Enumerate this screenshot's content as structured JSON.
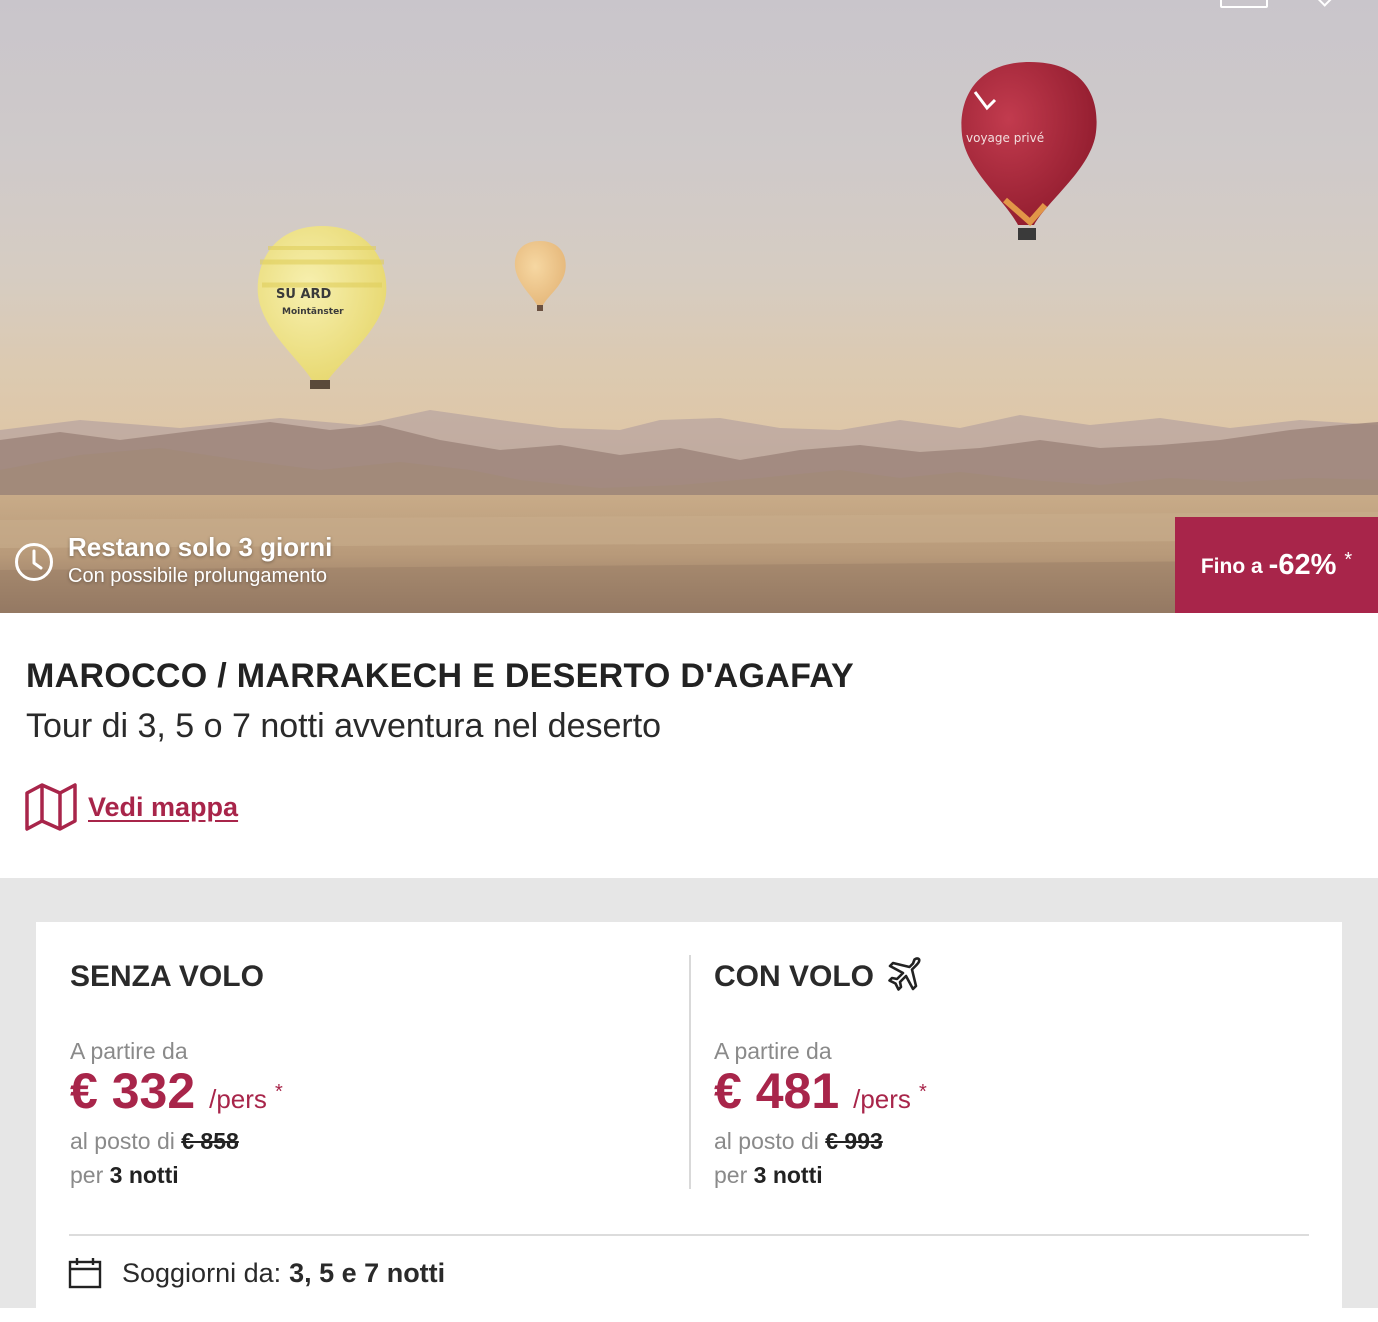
{
  "hero": {
    "countdown_title": "Restano solo 3 giorni",
    "countdown_sub": "Con possibile prolungamento",
    "discount_prefix": "Fino a",
    "discount_value": "-62%",
    "discount_star": "*",
    "balloon_text_left_1": "SU    ARD",
    "balloon_text_left_2": "Mointänster",
    "balloon_text_right": "voyage privé"
  },
  "offer": {
    "title": "MAROCCO / MARRAKECH E DESERTO D'AGAFAY",
    "subtitle": "Tour di 3, 5 o 7 notti avventura nel deserto",
    "map_link": "Vedi mappa"
  },
  "prices": {
    "without_flight": {
      "heading": "SENZA VOLO",
      "from_label": "A partire da",
      "price": "€ 332",
      "unit": "/pers",
      "star": "*",
      "was_prefix": "al posto di",
      "was_price": "€ 858",
      "nights_prefix": "per",
      "nights": "3 notti"
    },
    "with_flight": {
      "heading": "CON VOLO",
      "from_label": "A partire da",
      "price": "€ 481",
      "unit": "/pers",
      "star": "*",
      "was_prefix": "al posto di",
      "was_price": "€ 993",
      "nights_prefix": "per",
      "nights": "3 notti"
    },
    "stays_label": "Soggiorni da:",
    "stays_value": "3, 5 e 7 notti"
  },
  "colors": {
    "accent": "#a8254a",
    "muted_text": "#8a8a8a",
    "page_bg": "#e6e6e6"
  },
  "icons": [
    "clock-icon",
    "map-icon",
    "plane-icon",
    "calendar-icon"
  ]
}
